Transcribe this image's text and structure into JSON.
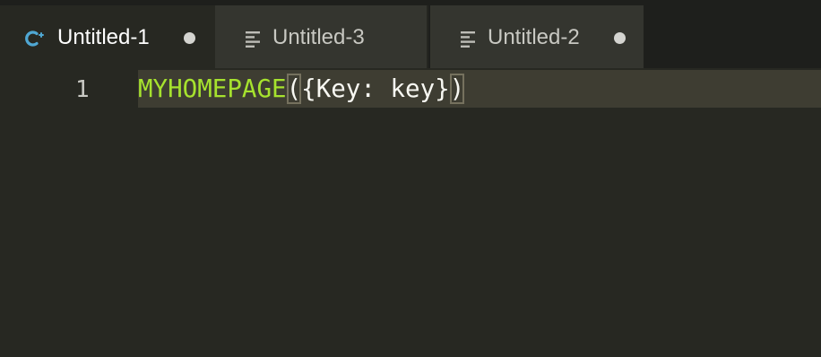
{
  "tabs": [
    {
      "label": "Untitled-1",
      "icon": "c-language-icon",
      "active": true,
      "dirty": true
    },
    {
      "label": "Untitled-3",
      "icon": "plain-text-icon",
      "active": false,
      "dirty": false
    },
    {
      "label": "Untitled-2",
      "icon": "plain-text-icon",
      "active": false,
      "dirty": true
    }
  ],
  "editor": {
    "line_number": "1",
    "code": {
      "function_name": "MYHOMEPAGE",
      "open_paren": "(",
      "args": "{Key: key}",
      "close_paren": ")"
    }
  },
  "colors": {
    "background": "#272822",
    "function": "#a6e22e",
    "text": "#f8f8f2",
    "current_line": "#3e3d32",
    "c_icon": "#4fa7d3"
  }
}
